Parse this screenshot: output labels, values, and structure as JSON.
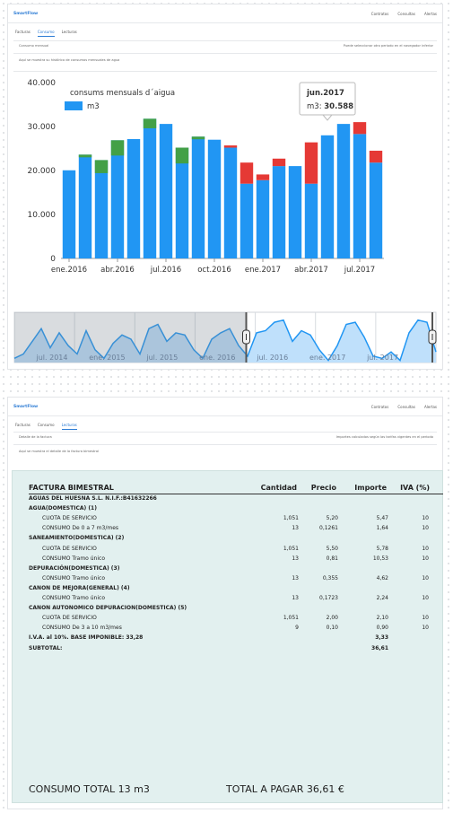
{
  "colors": {
    "accent": "#2b7bd4",
    "bar": "#2196f3",
    "down": "#e53935",
    "up": "#43a047",
    "invoice_bg": "#e2f0ef"
  },
  "panel1": {
    "brand": "SmartFlow",
    "nav": [
      "Contratos",
      "Consultas",
      "Alertas"
    ],
    "tabs": [
      "Facturas",
      "Consumo",
      "Lecturas"
    ],
    "info_title": "Consumo mensual",
    "info_right": "Puede seleccionar otro periodo en el navegador inferior",
    "info_body": "Aquí se muestra su histórico de consumos mensuales de agua"
  },
  "panel2": {
    "brand": "SmartFlow",
    "nav": [
      "Contratos",
      "Consultas",
      "Alertas"
    ],
    "tabs": [
      "Facturas",
      "Consumo",
      "Lecturas"
    ],
    "info_title": "Detalle de la factura",
    "info_right": "Importes calculados según las tarifas vigentes en el periodo",
    "info_body": "Aquí se muestra el detalle de la factura bimestral"
  },
  "chart_data": {
    "type": "bar",
    "title": "consums mensuals d´aigua",
    "series": [
      {
        "name": "m3",
        "values": [
          20046,
          23604,
          22365,
          26873,
          27155,
          31766,
          30588,
          25200,
          27700,
          27000,
          25200,
          17000,
          17800,
          21000,
          21000,
          17000,
          28000,
          30588,
          28300,
          21800
        ]
      }
    ],
    "changes": [
      null,
      23000,
      19400,
      23400,
      null,
      29600,
      null,
      21600,
      27100,
      null,
      25700,
      21800,
      19100,
      22700,
      null,
      26400,
      null,
      null,
      31000,
      24500
    ],
    "x": [
      "gen.2016",
      "feb.2016",
      "mar.2016",
      "abr.2016",
      "mai.2016",
      "jun.2016",
      "jul.2016",
      "ago.2016",
      "set.2016",
      "oct.2016",
      "nov.2016",
      "dic.2016",
      "ene.2017",
      "feb.2017",
      "mar.2017",
      "abr.2017",
      "mai.2017",
      "jun.2017",
      "jul.2017",
      "ago.2017"
    ],
    "xticks": [
      {
        "index": 0,
        "label": "ene.2016"
      },
      {
        "index": 3,
        "label": "abr.2016"
      },
      {
        "index": 6,
        "label": "jul.2016"
      },
      {
        "index": 9,
        "label": "oct.2016"
      },
      {
        "index": 12,
        "label": "ene.2017"
      },
      {
        "index": 15,
        "label": "abr.2017"
      },
      {
        "index": 18,
        "label": "jul.2017"
      }
    ],
    "yticks": [
      "0",
      "10.000",
      "20.000",
      "30.000",
      "40.000"
    ],
    "ylim": [
      0,
      40000
    ],
    "legend": "top-left",
    "grid": false,
    "tooltip": {
      "title": "jun.2017",
      "label": "m3: ",
      "value": "30.588"
    },
    "navigator": {
      "labels": [
        "jul. 2014",
        "ene. 2015",
        "jul. 2015",
        "ene. 2016",
        "jul. 2016",
        "ene. 2017",
        "jul. 2017"
      ],
      "values": [
        2,
        4,
        10,
        16,
        7,
        14,
        8,
        4,
        15,
        6,
        2,
        9,
        13,
        11,
        4,
        16,
        18,
        10,
        14,
        13,
        6,
        2,
        11,
        14,
        16,
        8,
        3,
        14,
        15,
        19,
        20,
        10,
        15,
        13,
        6,
        1,
        8,
        18,
        19,
        12,
        3,
        2,
        5,
        1,
        14,
        20,
        19,
        5
      ],
      "selection": [
        0.55,
        1.0
      ]
    }
  },
  "invoice": {
    "title": "FACTURA BIMESTRAL",
    "cols": [
      "Cantidad",
      "Precio",
      "Importe",
      "IVA (%)"
    ],
    "rows": [
      {
        "label": "AGUAS DEL HUESNA S.L.  N.I.F.:B41632266",
        "kind": "b"
      },
      {
        "label": "AGUA(DOMESTICA) (1)",
        "kind": "b"
      },
      {
        "label": "CUOTA DE SERVICIO",
        "kind": "sub",
        "qty": "1,051",
        "price": "5,20",
        "amount": "5,47",
        "iva": "10"
      },
      {
        "label": "CONSUMO De 0 a 7 m3/mes",
        "kind": "sub",
        "qty": "13",
        "price": "0,1261",
        "amount": "1,64",
        "iva": "10"
      },
      {
        "label": "SANEAMIENTO(DOMESTICA) (2)",
        "kind": "b"
      },
      {
        "label": "CUOTA DE SERVICIO",
        "kind": "sub",
        "qty": "1,051",
        "price": "5,50",
        "amount": "5,78",
        "iva": "10"
      },
      {
        "label": "CONSUMO Tramo único",
        "kind": "sub",
        "qty": "13",
        "price": "0,81",
        "amount": "10,53",
        "iva": "10"
      },
      {
        "label": "DEPURACIÓN(DOMESTICA) (3)",
        "kind": "b"
      },
      {
        "label": "CONSUMO Tramo único",
        "kind": "sub",
        "qty": "13",
        "price": "0,355",
        "amount": "4,62",
        "iva": "10"
      },
      {
        "label": "CANON DE MEJORA(GENERAL) (4)",
        "kind": "b"
      },
      {
        "label": "CONSUMO Tramo único",
        "kind": "sub",
        "qty": "13",
        "price": "0,1723",
        "amount": "2,24",
        "iva": "10"
      },
      {
        "label": "CANON AUTONOMICO DEPURACION(DOMESTICA) (5)",
        "kind": "b"
      },
      {
        "label": "CUOTA DE SERVICIO",
        "kind": "sub",
        "qty": "1,051",
        "price": "2,00",
        "amount": "2,10",
        "iva": "10"
      },
      {
        "label": "CONSUMO De 3 a 10 m3/mes",
        "kind": "sub",
        "qty": "9",
        "price": "0,10",
        "amount": "0,90",
        "iva": "10"
      },
      {
        "label": "I.V.A. al 10%. BASE IMPONIBLE: 33,28",
        "kind": "b",
        "amount": "3,33"
      },
      {
        "label": "SUBTOTAL:",
        "kind": "b",
        "amount": "36,61"
      }
    ],
    "consumo_total": "CONSUMO TOTAL 13 m3",
    "total_pagar": "TOTAL A PAGAR 36,61 €"
  }
}
